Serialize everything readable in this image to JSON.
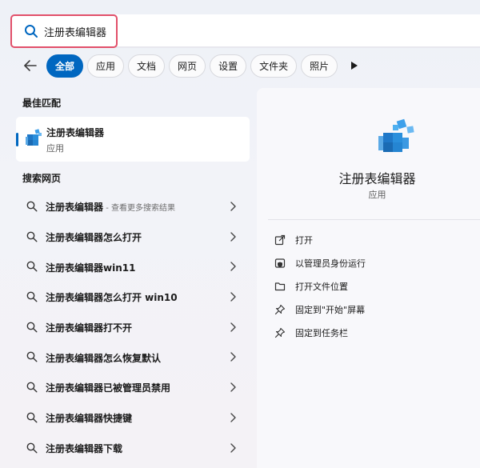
{
  "search": {
    "value": "注册表编辑器",
    "highlight_color": "#e2506a"
  },
  "filters": {
    "back_icon": "arrow-left-icon",
    "chips": [
      "全部",
      "应用",
      "文档",
      "网页",
      "设置",
      "文件夹",
      "照片"
    ],
    "active_index": 0,
    "more_icon": "play-icon",
    "accent_color": "#0067c0"
  },
  "best_match": {
    "heading": "最佳匹配",
    "name": "注册表编辑器",
    "type": "应用",
    "icon": "registry-editor-icon"
  },
  "web": {
    "heading": "搜索网页",
    "items": [
      {
        "text": "注册表编辑器",
        "sub": " - 查看更多搜索结果"
      },
      {
        "text": "注册表编辑器怎么打开",
        "sub": ""
      },
      {
        "text": "注册表编辑器win11",
        "sub": ""
      },
      {
        "text": "注册表编辑器怎么打开 win10",
        "sub": ""
      },
      {
        "text": "注册表编辑器打不开",
        "sub": ""
      },
      {
        "text": "注册表编辑器怎么恢复默认",
        "sub": ""
      },
      {
        "text": "注册表编辑器已被管理员禁用",
        "sub": ""
      },
      {
        "text": "注册表编辑器快捷键",
        "sub": ""
      },
      {
        "text": "注册表编辑器下载",
        "sub": ""
      }
    ]
  },
  "detail": {
    "name": "注册表编辑器",
    "type": "应用",
    "actions": [
      {
        "label": "打开",
        "icon": "open-external-icon"
      },
      {
        "label": "以管理员身份运行",
        "icon": "shield-admin-icon"
      },
      {
        "label": "打开文件位置",
        "icon": "folder-icon"
      },
      {
        "label": "固定到\"开始\"屏幕",
        "icon": "pin-icon"
      },
      {
        "label": "固定到任务栏",
        "icon": "pin-icon"
      }
    ]
  }
}
